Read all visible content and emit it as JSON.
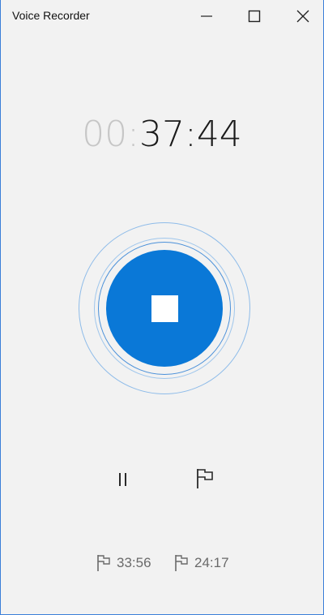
{
  "window": {
    "title": "Voice Recorder",
    "accent_color": "#0a78d7"
  },
  "timer": {
    "hours": "00",
    "separator": ":",
    "elapsed": "37:44"
  },
  "controls": {
    "stop_icon": "stop-icon",
    "pause_icon": "pause-icon",
    "flag_icon": "flag-icon"
  },
  "markers": [
    {
      "icon": "flag-icon",
      "time": "33:56"
    },
    {
      "icon": "flag-icon",
      "time": "24:17"
    }
  ]
}
